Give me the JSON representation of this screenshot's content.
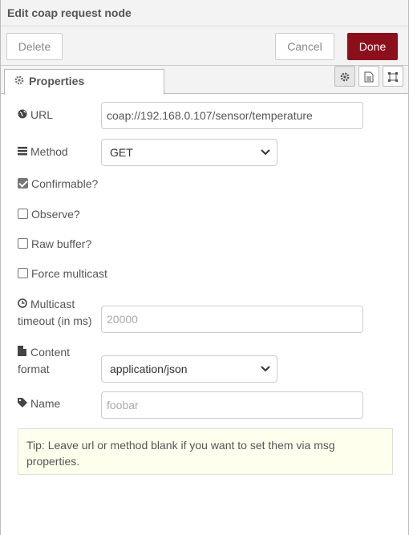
{
  "header": {
    "title": "Edit coap request node"
  },
  "toolbar": {
    "delete_label": "Delete",
    "cancel_label": "Cancel",
    "done_label": "Done"
  },
  "tabs": [
    {
      "label": "Properties",
      "icon": "gear-icon"
    }
  ],
  "tab_icons": [
    "gear-icon",
    "document-icon",
    "frame-icon"
  ],
  "form": {
    "url": {
      "label": "URL",
      "icon": "globe-icon",
      "value": "coap://192.168.0.107/sensor/temperature"
    },
    "method": {
      "label": "Method",
      "icon": "tasks-icon",
      "value": "GET"
    },
    "confirmable": {
      "label": "Confirmable?",
      "checked": true
    },
    "observe": {
      "label": "Observe?",
      "checked": false
    },
    "raw_buffer": {
      "label": "Raw buffer?",
      "checked": false
    },
    "force_multicast": {
      "label": "Force multicast",
      "checked": false
    },
    "multicast_timeout": {
      "label_line1": "Multicast",
      "label_line2": "timeout (in ms)",
      "icon": "clock-icon",
      "placeholder": "20000"
    },
    "content_format": {
      "label_line1": "Content",
      "label_line2": "format",
      "icon": "file-icon",
      "value": "application/json"
    },
    "name": {
      "label": "Name",
      "icon": "tag-icon",
      "placeholder": "foobar"
    }
  },
  "tip": {
    "text": "Tip: Leave url or method blank if you want to set them via msg properties."
  },
  "colors": {
    "done": "#8c101c",
    "tip_bg": "#ffffee"
  }
}
